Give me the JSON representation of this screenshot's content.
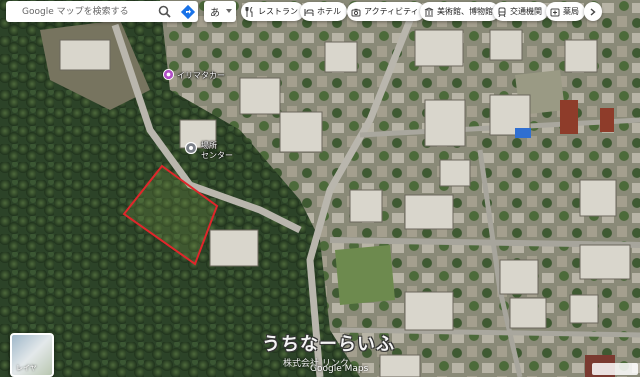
{
  "search": {
    "placeholder": "Google マップを検索する"
  },
  "ime": {
    "label": "あ"
  },
  "chips": [
    {
      "label": "レストラン",
      "icon": "restaurant-icon"
    },
    {
      "label": "ホテル",
      "icon": "hotel-icon"
    },
    {
      "label": "アクティビティ",
      "icon": "camera-icon"
    },
    {
      "label": "美術館、博物館",
      "icon": "museum-icon"
    },
    {
      "label": "交通機関",
      "icon": "transit-icon"
    },
    {
      "label": "薬局",
      "icon": "pharmacy-icon"
    }
  ],
  "pois": [
    {
      "label": "イリマタカー",
      "icon": "pin-icon"
    },
    {
      "label": "場所",
      "icon": "pin-icon"
    },
    {
      "label": "センター",
      "icon": "pin-icon"
    }
  ],
  "layers": {
    "label": "レイヤ"
  },
  "watermark": {
    "title": "うちなーらいふ",
    "company": "株式会社 リンク"
  },
  "attribution": "Google Maps",
  "colors": {
    "boundary": "#e0262b",
    "chip_bg": "#ffffff",
    "forest": "#2f4a2b"
  }
}
